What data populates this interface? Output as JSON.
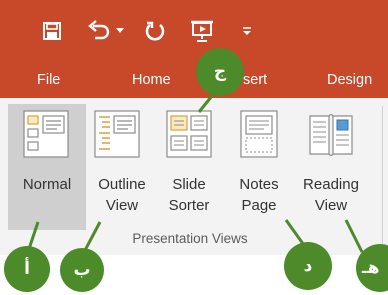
{
  "colors": {
    "title_bar": "#c8482a",
    "ribbon_bg": "#f3f3f3",
    "selected_button_bg": "#cfcfcf",
    "callout_green": "#4c8a2a",
    "group_label_text": "#5b5b5b"
  },
  "quick_access_toolbar": {
    "icons": [
      "save-icon",
      "undo-icon",
      "undo-dropdown-icon",
      "redo-icon",
      "present-from-beginning-icon",
      "customize-qat-icon"
    ]
  },
  "tabs": [
    {
      "label": "File"
    },
    {
      "label": "Home"
    },
    {
      "label": "sert"
    },
    {
      "label": "Design"
    }
  ],
  "view_buttons": [
    {
      "label_line1": "Normal",
      "label_line2": "",
      "icon": "normal-view-icon",
      "selected": true
    },
    {
      "label_line1": "Outline",
      "label_line2": "View",
      "icon": "outline-view-icon",
      "selected": false
    },
    {
      "label_line1": "Slide",
      "label_line2": "Sorter",
      "icon": "slide-sorter-icon",
      "selected": false
    },
    {
      "label_line1": "Notes",
      "label_line2": "Page",
      "icon": "notes-page-icon",
      "selected": false
    },
    {
      "label_line1": "Reading",
      "label_line2": "View",
      "icon": "reading-view-icon",
      "selected": false
    }
  ],
  "group_label": "Presentation Views",
  "callouts": [
    {
      "letter": "ج"
    },
    {
      "letter": "أ"
    },
    {
      "letter": "ب"
    },
    {
      "letter": "د"
    },
    {
      "letter": "هـ"
    }
  ]
}
